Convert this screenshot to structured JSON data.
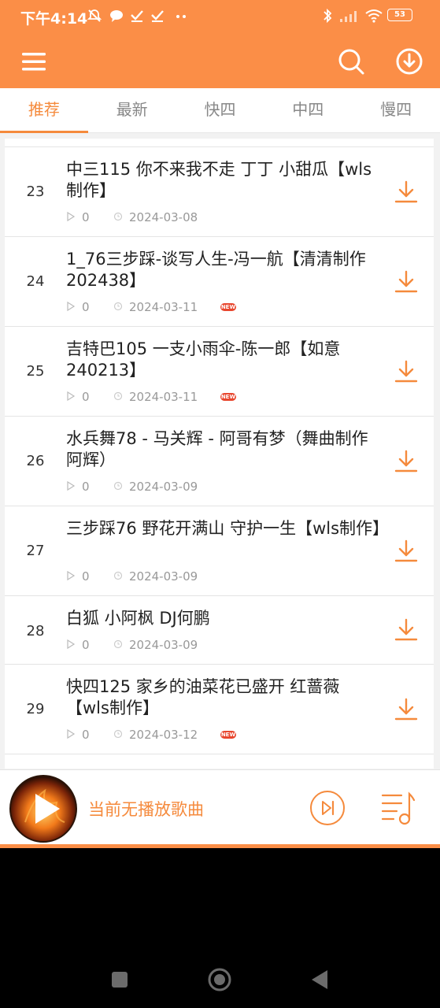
{
  "status_bar": {
    "time": "下午4:14",
    "battery": "53"
  },
  "toolbar": {
    "menu_icon": "menu-icon",
    "search_icon": "search-icon",
    "download_icon": "download-circle-icon"
  },
  "tabs": [
    {
      "label": "推荐",
      "active": true
    },
    {
      "label": "最新",
      "active": false
    },
    {
      "label": "快四",
      "active": false
    },
    {
      "label": "中四",
      "active": false
    },
    {
      "label": "慢四",
      "active": false
    }
  ],
  "songs": [
    {
      "index": "23",
      "title": "中三115  你不来我不走  丁丁 小甜瓜【wls制作】",
      "plays": "0",
      "date": "2024-03-08",
      "is_new": false
    },
    {
      "index": "24",
      "title": "1_76三步踩-谈写人生-冯一航【清清制作202438】",
      "plays": "0",
      "date": "2024-03-11",
      "is_new": true
    },
    {
      "index": "25",
      "title": "吉特巴105 一支小雨伞-陈一郎【如意240213】",
      "plays": "0",
      "date": "2024-03-11",
      "is_new": true
    },
    {
      "index": "26",
      "title": "水兵舞78 - 马关辉 - 阿哥有梦（舞曲制作阿辉）",
      "plays": "0",
      "date": "2024-03-09",
      "is_new": false
    },
    {
      "index": "27",
      "title": "三步踩76 野花开满山  守护一生【wls制作】",
      "plays": "0",
      "date": "2024-03-09",
      "is_new": false
    },
    {
      "index": "28",
      "title": "白狐  小阿枫  DJ何鹏",
      "plays": "0",
      "date": "2024-03-09",
      "is_new": false
    },
    {
      "index": "29",
      "title": "快四125 家乡的油菜花已盛开  红蔷薇【wls制作】",
      "plays": "0",
      "date": "2024-03-12",
      "is_new": true
    }
  ],
  "new_badge_text": "NEW",
  "player": {
    "now_playing": "当前无播放歌曲"
  },
  "colors": {
    "accent": "#fb8e47",
    "tab_active": "#f58a3c",
    "new_badge": "#e8462e"
  }
}
